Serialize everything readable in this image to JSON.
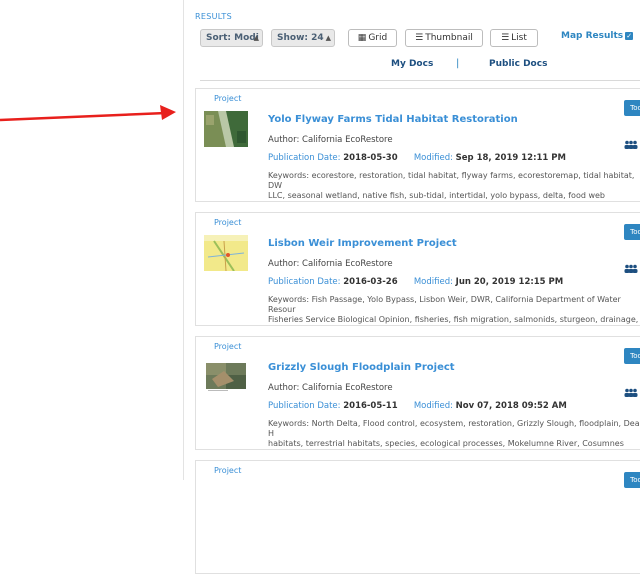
{
  "results_label": "RESULTS",
  "sort": {
    "label": "Sort: Modi"
  },
  "show": {
    "label": "Show: 24"
  },
  "views": [
    {
      "label": "Grid",
      "icon": "grid-icon"
    },
    {
      "label": "Thumbnail",
      "icon": "thumbnail-list-icon"
    },
    {
      "label": "List",
      "icon": "list-icon"
    }
  ],
  "map_results": {
    "label": "Map Results",
    "checked": true
  },
  "tabs": {
    "my_docs": "My Docs",
    "public_docs": "Public Docs",
    "separator": "|"
  },
  "colors": {
    "accent": "#3a8fd6",
    "arrow": "#e8201c",
    "tools_button": "#2e86c1"
  },
  "results": [
    {
      "type": "Project",
      "title": "Yolo Flyway Farms Tidal Habitat Restoration",
      "author": "Author: California EcoRestore",
      "pub_label": "Publication Date:",
      "pub_date": "2018-05-30",
      "mod_label": "Modified:",
      "mod_date": "Sep 18, 2019 12:11 PM",
      "keywords": "Keywords: ecorestore, restoration, tidal habitat, flyway farms, ecorestoremap, tidal habitat, DW\nLLC, seasonal wetland, native fish, sub-tidal, intertidal, yolo bypass, delta, food web production\ndrain, transitional uplands, delta smelt, homepagemap,yolobypassdash,Yolo Basin",
      "tools": "Too"
    },
    {
      "type": "Project",
      "title": "Lisbon Weir Improvement Project",
      "author": "Author: California EcoRestore",
      "pub_label": "Publication Date:",
      "pub_date": "2016-03-26",
      "mod_label": "Modified:",
      "mod_date": "Jun 20, 2019 12:15 PM",
      "keywords": "Keywords: Fish Passage, Yolo Bypass, Lisbon Weir, DWR, California Department of Water Resour\nFisheries Service Biological Opinion, fisheries, fish migration, salmonids, sturgeon, drainage, Tu\nrestoration, habitat,sarahmap, ecorestore, homepagemap, yolobypassdash,Yolo Basin",
      "tools": "Too"
    },
    {
      "type": "Project",
      "title": "Grizzly Slough Floodplain Project",
      "author": "Author: California EcoRestore",
      "pub_label": "Publication Date:",
      "pub_date": "2016-05-11",
      "mod_label": "Modified:",
      "mod_date": "Nov 07, 2018 09:52 AM",
      "keywords": "Keywords: North Delta, Flood control, ecosystem, restoration, Grizzly Slough, floodplain, Dead H\nhabitats, terrestrial habitats, species, ecological processes, Mokelumne River, Cosumnes River, D\nCreeks, Consumnes Preserve, levees, ecorestore, homepagemap",
      "tools": "Too"
    },
    {
      "type": "Project",
      "tools": "Too"
    }
  ]
}
